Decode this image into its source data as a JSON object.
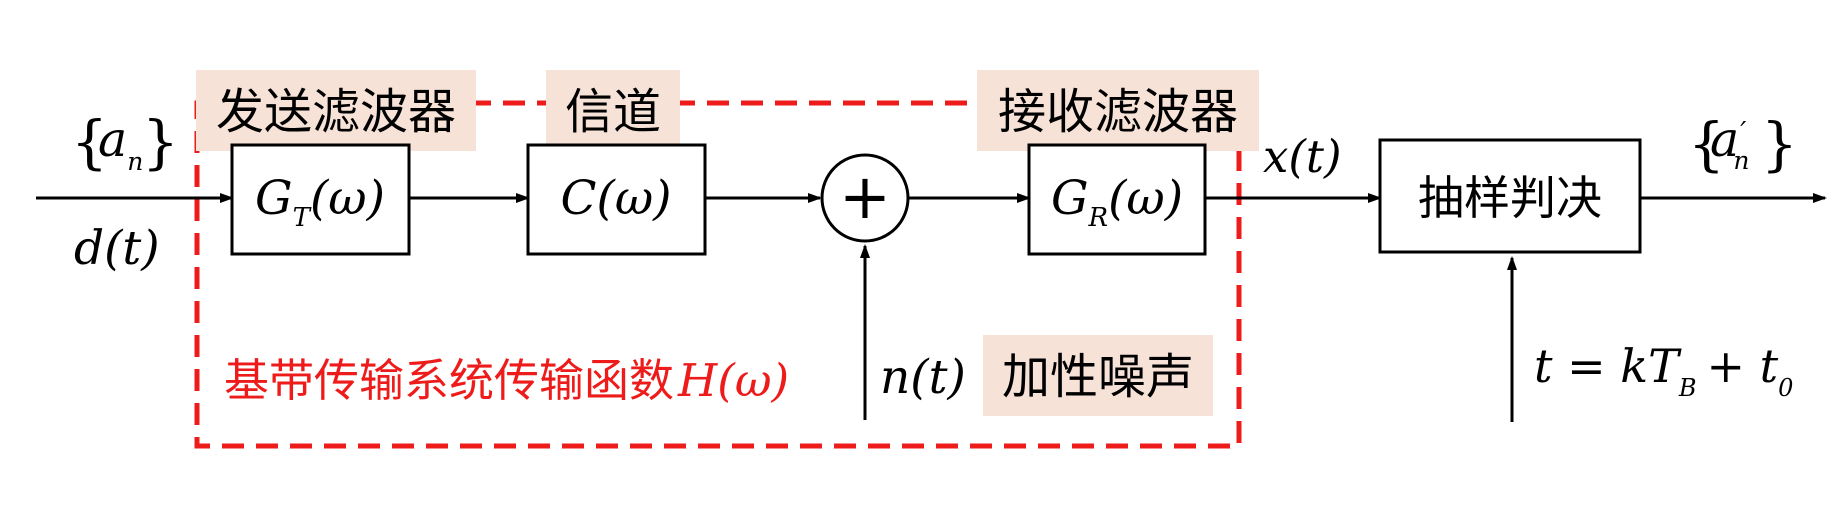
{
  "colors": {
    "line": "#000000",
    "highlight_fill": "#f6e2d7",
    "dashed_outline": "#ee1b1b",
    "system_label": "#ee1b1b"
  },
  "labels": {
    "transmit_filter": "发送滤波器",
    "channel": "信道",
    "receive_filter": "接收滤波器",
    "additive_noise": "加性噪声",
    "system_function_text": "基带传输系统传输函数"
  },
  "math": {
    "input_symbol": "a",
    "input_symbol_sub": "n",
    "input_signal": "d(t)",
    "transmit_block_main": "G",
    "transmit_block_sub": "T",
    "transmit_block_arg": "(ω)",
    "channel_block": "C(ω)",
    "receive_block_main": "G",
    "receive_block_sub": "R",
    "receive_block_arg": "(ω)",
    "summing_symbol": "+",
    "noise_signal": "n(t)",
    "output_signal": "x(t)",
    "system_function_symbol": "H(ω)",
    "output_symbol": "a",
    "output_symbol_prime": "′",
    "output_symbol_sub": "n",
    "sampling_time_main": "t = kT",
    "sampling_time_sub": "B",
    "sampling_time_plus": "+ t",
    "sampling_time_zero": "0"
  },
  "decision_block": {
    "label": "抽样判决"
  }
}
